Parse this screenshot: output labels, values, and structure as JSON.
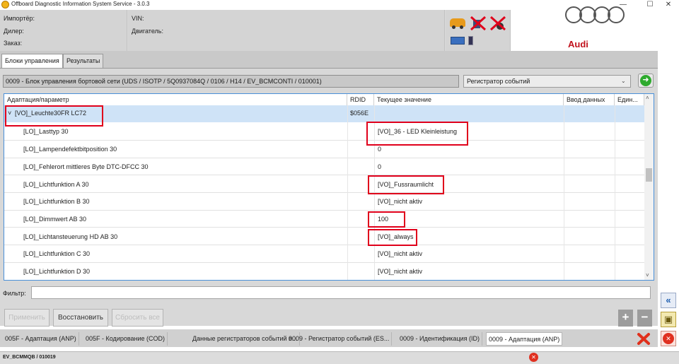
{
  "window": {
    "title": "Offboard Diagnostic Information System Service - 3.0.3",
    "minimize": "—",
    "maximize": "☐",
    "close": "✕"
  },
  "header": {
    "importer_label": "Импортёр:",
    "dealer_label": "Дилер:",
    "order_label": "Заказ:",
    "vin_label": "VIN:",
    "engine_label": "Двигатель:",
    "brand": "Audi"
  },
  "tabs": [
    {
      "label": "Блоки управления"
    },
    {
      "label": "Результаты"
    }
  ],
  "ecu": {
    "path": "0009 - Блок управления бортовой сети  (UDS / ISOTP / 5Q0937084Q  / 0106 / H14 / EV_BCMCONTI / 010001)"
  },
  "dropdown": {
    "selected": "Регистратор событий",
    "arrow": "⌄"
  },
  "go_button": {
    "glyph": "➜"
  },
  "table": {
    "columns": [
      "Адаптация/параметр",
      "RDID",
      "Текущее значение",
      "Ввод данных",
      "Един..."
    ],
    "group": {
      "expander": "˅",
      "name": "[VO]_Leuchte30FR LC72",
      "rdid": "$056E"
    },
    "rows": [
      {
        "param": "[LO]_Lasttyp 30",
        "value": "[VO]_36 - LED Kleinleistung"
      },
      {
        "param": "[LO]_Lampendefektbitposition 30",
        "value": "0"
      },
      {
        "param": "[LO]_Fehlerort mittleres Byte DTC-DFCC 30",
        "value": "0"
      },
      {
        "param": "[LO]_Lichtfunktion A 30",
        "value": "[VO]_Fussraumlicht"
      },
      {
        "param": "[LO]_Lichtfunktion B 30",
        "value": "[VO]_nicht aktiv"
      },
      {
        "param": "[LO]_Dimmwert AB 30",
        "value": "100"
      },
      {
        "param": "[LO]_Lichtansteuerung HD AB 30",
        "value": "[VO]_always"
      },
      {
        "param": "[LO]_Lichtfunktion C 30",
        "value": "[VO]_nicht aktiv"
      },
      {
        "param": "[LO]_Lichtfunktion D 30",
        "value": "[VO]_nicht aktiv"
      }
    ]
  },
  "filter": {
    "label": "Фильтр:",
    "value": ""
  },
  "buttons": {
    "apply": "Применить",
    "restore": "Восстановить",
    "reset_all": "Сбросить все",
    "plus": "+",
    "minus": "−"
  },
  "bottom_tabs": [
    {
      "label": "005F - Адаптация (ANP)"
    },
    {
      "label": "005F - Кодирование (COD)"
    },
    {
      "label": "Данные регистраторов событий в..."
    },
    {
      "label": "0009 - Регистратор событий (ES..."
    },
    {
      "label": "0009 - Идентификация (ID)"
    },
    {
      "label": "0009 - Адаптация (ANP)"
    }
  ],
  "status": {
    "text": "EV_BCMMQB / 010019"
  },
  "side_toolbar": {
    "collapse": "«",
    "fit": "▣",
    "close": "✕"
  },
  "colors": {
    "accent": "#4a90d9",
    "highlight": "#e0001b",
    "selection": "#cfe3f7",
    "brand_red": "#c1121c"
  }
}
